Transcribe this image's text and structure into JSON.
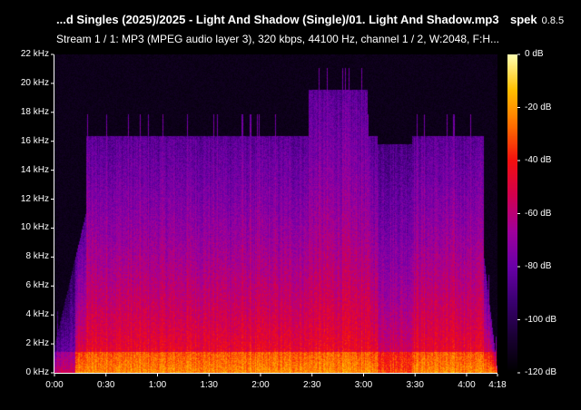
{
  "header": {
    "file_title": "...d Singles (2025)/2025 - Light And Shadow (Single)/01. Light And Shadow.mp3",
    "app_name": "spek",
    "app_version": "0.8.5",
    "stream_info": "Stream 1 / 1: MP3 (MPEG audio layer 3), 320 kbps, 44100 Hz, channel 1 / 2, W:2048, F:H..."
  },
  "spectrogram": {
    "frequency_axis": [
      "0 kHz",
      "2 kHz",
      "4 kHz",
      "6 kHz",
      "8 kHz",
      "10 kHz",
      "12 kHz",
      "14 kHz",
      "16 kHz",
      "18 kHz",
      "20 kHz",
      "22 kHz"
    ],
    "frequency_values_khz": [
      0,
      2,
      4,
      6,
      8,
      10,
      12,
      14,
      16,
      18,
      20,
      22
    ],
    "time_axis": [
      "0:00",
      "0:30",
      "1:00",
      "1:30",
      "2:00",
      "2:30",
      "3:00",
      "3:30",
      "4:00",
      "4:18"
    ],
    "time_values_s": [
      0,
      30,
      60,
      90,
      120,
      150,
      180,
      210,
      240,
      258
    ],
    "duration_s": 258,
    "max_freq_khz": 22
  },
  "colorbar": {
    "labels": [
      "0 dB",
      "-20 dB",
      "-40 dB",
      "-60 dB",
      "-80 dB",
      "-100 dB",
      "-120 dB"
    ],
    "values_db": [
      0,
      -20,
      -40,
      -60,
      -80,
      -100,
      -120
    ],
    "min_db": -120,
    "max_db": 0
  },
  "colors": {
    "background": "#000000",
    "text": "#ffffff",
    "scale": [
      "#000000",
      "#1a0033",
      "#3a0070",
      "#6a00a8",
      "#a0009c",
      "#d20050",
      "#f31010",
      "#ff7000",
      "#ffc000",
      "#ffffb0"
    ]
  }
}
